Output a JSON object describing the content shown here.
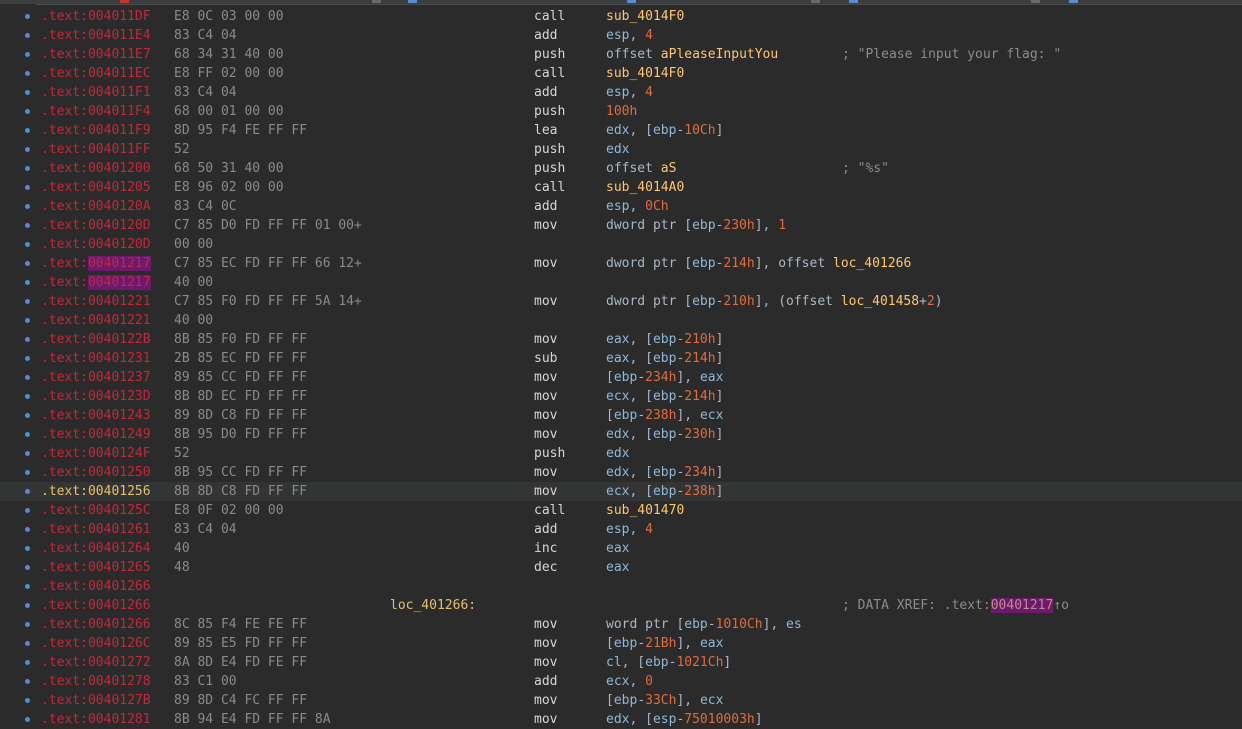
{
  "rows": [
    {
      "seg": ".text:",
      "addr": "004011DF",
      "bytes": "E8 0C 03 00 00",
      "mnem": "call",
      "ops": [
        {
          "t": "sub_4014F0",
          "c": "sym"
        }
      ]
    },
    {
      "seg": ".text:",
      "addr": "004011E4",
      "bytes": "83 C4 04",
      "mnem": "add",
      "ops": [
        {
          "t": "esp",
          "c": "reg"
        },
        {
          "t": ", "
        },
        {
          "t": "4",
          "c": "num"
        }
      ]
    },
    {
      "seg": ".text:",
      "addr": "004011E7",
      "bytes": "68 34 31 40 00",
      "mnem": "push",
      "ops": [
        {
          "t": "offset "
        },
        {
          "t": "aPleaseInputYou",
          "c": "sym"
        }
      ],
      "comment": "; \"Please input your flag: \""
    },
    {
      "seg": ".text:",
      "addr": "004011EC",
      "bytes": "E8 FF 02 00 00",
      "mnem": "call",
      "ops": [
        {
          "t": "sub_4014F0",
          "c": "sym"
        }
      ]
    },
    {
      "seg": ".text:",
      "addr": "004011F1",
      "bytes": "83 C4 04",
      "mnem": "add",
      "ops": [
        {
          "t": "esp",
          "c": "reg"
        },
        {
          "t": ", "
        },
        {
          "t": "4",
          "c": "num"
        }
      ]
    },
    {
      "seg": ".text:",
      "addr": "004011F4",
      "bytes": "68 00 01 00 00",
      "mnem": "push",
      "ops": [
        {
          "t": "100h",
          "c": "num"
        }
      ]
    },
    {
      "seg": ".text:",
      "addr": "004011F9",
      "bytes": "8D 95 F4 FE FF FF",
      "mnem": "lea",
      "ops": [
        {
          "t": "edx",
          "c": "reg"
        },
        {
          "t": ", ["
        },
        {
          "t": "ebp",
          "c": "reg"
        },
        {
          "t": "-"
        },
        {
          "t": "10Ch",
          "c": "num"
        },
        {
          "t": "]"
        }
      ]
    },
    {
      "seg": ".text:",
      "addr": "004011FF",
      "bytes": "52",
      "mnem": "push",
      "ops": [
        {
          "t": "edx",
          "c": "reg"
        }
      ]
    },
    {
      "seg": ".text:",
      "addr": "00401200",
      "bytes": "68 50 31 40 00",
      "mnem": "push",
      "ops": [
        {
          "t": "offset "
        },
        {
          "t": "aS",
          "c": "sym"
        }
      ],
      "comment": "; \"%s\""
    },
    {
      "seg": ".text:",
      "addr": "00401205",
      "bytes": "E8 96 02 00 00",
      "mnem": "call",
      "ops": [
        {
          "t": "sub_4014A0",
          "c": "sym"
        }
      ]
    },
    {
      "seg": ".text:",
      "addr": "0040120A",
      "bytes": "83 C4 0C",
      "mnem": "add",
      "ops": [
        {
          "t": "esp",
          "c": "reg"
        },
        {
          "t": ", "
        },
        {
          "t": "0Ch",
          "c": "num"
        }
      ]
    },
    {
      "seg": ".text:",
      "addr": "0040120D",
      "bytes": "C7 85 D0 FD FF FF 01 00+",
      "mnem": "mov",
      "ops": [
        {
          "t": "dword ptr ["
        },
        {
          "t": "ebp",
          "c": "reg"
        },
        {
          "t": "-"
        },
        {
          "t": "230h",
          "c": "num"
        },
        {
          "t": "], "
        },
        {
          "t": "1",
          "c": "num"
        }
      ]
    },
    {
      "seg": ".text:",
      "addr": "0040120D",
      "bytes": "00 00"
    },
    {
      "seg": ".text:",
      "addr": "00401217",
      "addrHl": true,
      "bytes": "C7 85 EC FD FF FF 66 12+",
      "mnem": "mov",
      "ops": [
        {
          "t": "dword ptr ["
        },
        {
          "t": "ebp",
          "c": "reg"
        },
        {
          "t": "-"
        },
        {
          "t": "214h",
          "c": "num"
        },
        {
          "t": "], offset "
        },
        {
          "t": "loc_401266",
          "c": "sym"
        }
      ]
    },
    {
      "seg": ".text:",
      "addr": "00401217",
      "addrHl": true,
      "bytes": "40 00"
    },
    {
      "seg": ".text:",
      "addr": "00401221",
      "bytes": "C7 85 F0 FD FF FF 5A 14+",
      "mnem": "mov",
      "ops": [
        {
          "t": "dword ptr ["
        },
        {
          "t": "ebp",
          "c": "reg"
        },
        {
          "t": "-"
        },
        {
          "t": "210h",
          "c": "num"
        },
        {
          "t": "], (offset "
        },
        {
          "t": "loc_401458",
          "c": "sym"
        },
        {
          "t": "+"
        },
        {
          "t": "2",
          "c": "num"
        },
        {
          "t": ")"
        }
      ]
    },
    {
      "seg": ".text:",
      "addr": "00401221",
      "bytes": "40 00"
    },
    {
      "seg": ".text:",
      "addr": "0040122B",
      "bytes": "8B 85 F0 FD FF FF",
      "mnem": "mov",
      "ops": [
        {
          "t": "eax",
          "c": "reg"
        },
        {
          "t": ", ["
        },
        {
          "t": "ebp",
          "c": "reg"
        },
        {
          "t": "-"
        },
        {
          "t": "210h",
          "c": "num"
        },
        {
          "t": "]"
        }
      ]
    },
    {
      "seg": ".text:",
      "addr": "00401231",
      "bytes": "2B 85 EC FD FF FF",
      "mnem": "sub",
      "ops": [
        {
          "t": "eax",
          "c": "reg"
        },
        {
          "t": ", ["
        },
        {
          "t": "ebp",
          "c": "reg"
        },
        {
          "t": "-"
        },
        {
          "t": "214h",
          "c": "num"
        },
        {
          "t": "]"
        }
      ]
    },
    {
      "seg": ".text:",
      "addr": "00401237",
      "bytes": "89 85 CC FD FF FF",
      "mnem": "mov",
      "ops": [
        {
          "t": "["
        },
        {
          "t": "ebp",
          "c": "reg"
        },
        {
          "t": "-"
        },
        {
          "t": "234h",
          "c": "num"
        },
        {
          "t": "], "
        },
        {
          "t": "eax",
          "c": "reg"
        }
      ]
    },
    {
      "seg": ".text:",
      "addr": "0040123D",
      "bytes": "8B 8D EC FD FF FF",
      "mnem": "mov",
      "ops": [
        {
          "t": "ecx",
          "c": "reg"
        },
        {
          "t": ", ["
        },
        {
          "t": "ebp",
          "c": "reg"
        },
        {
          "t": "-"
        },
        {
          "t": "214h",
          "c": "num"
        },
        {
          "t": "]"
        }
      ]
    },
    {
      "seg": ".text:",
      "addr": "00401243",
      "bytes": "89 8D C8 FD FF FF",
      "mnem": "mov",
      "ops": [
        {
          "t": "["
        },
        {
          "t": "ebp",
          "c": "reg"
        },
        {
          "t": "-"
        },
        {
          "t": "238h",
          "c": "num"
        },
        {
          "t": "], "
        },
        {
          "t": "ecx",
          "c": "reg"
        }
      ]
    },
    {
      "seg": ".text:",
      "addr": "00401249",
      "bytes": "8B 95 D0 FD FF FF",
      "mnem": "mov",
      "ops": [
        {
          "t": "edx",
          "c": "reg"
        },
        {
          "t": ", ["
        },
        {
          "t": "ebp",
          "c": "reg"
        },
        {
          "t": "-"
        },
        {
          "t": "230h",
          "c": "num"
        },
        {
          "t": "]"
        }
      ]
    },
    {
      "seg": ".text:",
      "addr": "0040124F",
      "bytes": "52",
      "mnem": "push",
      "ops": [
        {
          "t": "edx",
          "c": "reg"
        }
      ]
    },
    {
      "seg": ".text:",
      "addr": "00401250",
      "bytes": "8B 95 CC FD FF FF",
      "mnem": "mov",
      "ops": [
        {
          "t": "edx",
          "c": "reg"
        },
        {
          "t": ", ["
        },
        {
          "t": "ebp",
          "c": "reg"
        },
        {
          "t": "-"
        },
        {
          "t": "234h",
          "c": "num"
        },
        {
          "t": "]"
        }
      ]
    },
    {
      "seg": ".text:",
      "addr": "00401256",
      "current": true,
      "bytes": "8B 8D C8 FD FF FF",
      "mnem": "mov",
      "ops": [
        {
          "t": "ecx",
          "c": "reg"
        },
        {
          "t": ", ["
        },
        {
          "t": "ebp",
          "c": "reg"
        },
        {
          "t": "-"
        },
        {
          "t": "238h",
          "c": "num"
        },
        {
          "t": "]"
        }
      ]
    },
    {
      "seg": ".text:",
      "addr": "0040125C",
      "bytes": "E8 0F 02 00 00",
      "mnem": "call",
      "ops": [
        {
          "t": "sub_401470",
          "c": "sym"
        }
      ]
    },
    {
      "seg": ".text:",
      "addr": "00401261",
      "bytes": "83 C4 04",
      "mnem": "add",
      "ops": [
        {
          "t": "esp",
          "c": "reg"
        },
        {
          "t": ", "
        },
        {
          "t": "4",
          "c": "num"
        }
      ]
    },
    {
      "seg": ".text:",
      "addr": "00401264",
      "bytes": "40",
      "mnem": "inc",
      "ops": [
        {
          "t": "eax",
          "c": "reg"
        }
      ]
    },
    {
      "seg": ".text:",
      "addr": "00401265",
      "bytes": "48",
      "mnem": "dec",
      "ops": [
        {
          "t": "eax",
          "c": "reg"
        }
      ]
    },
    {
      "seg": ".text:",
      "addr": "00401266"
    },
    {
      "seg": ".text:",
      "addr": "00401266",
      "label": "loc_401266:",
      "comment": "; DATA XREF: .text:",
      "xref": "00401217",
      "xrefTail": "↑o"
    },
    {
      "seg": ".text:",
      "addr": "00401266",
      "bytes": "8C 85 F4 FE FE FF",
      "mnem": "mov",
      "ops": [
        {
          "t": "word ptr ["
        },
        {
          "t": "ebp",
          "c": "reg"
        },
        {
          "t": "-"
        },
        {
          "t": "1010Ch",
          "c": "num"
        },
        {
          "t": "], "
        },
        {
          "t": "es",
          "c": "reg"
        }
      ]
    },
    {
      "seg": ".text:",
      "addr": "0040126C",
      "bytes": "89 85 E5 FD FF FF",
      "mnem": "mov",
      "ops": [
        {
          "t": "["
        },
        {
          "t": "ebp",
          "c": "reg"
        },
        {
          "t": "-"
        },
        {
          "t": "21Bh",
          "c": "num"
        },
        {
          "t": "], "
        },
        {
          "t": "eax",
          "c": "reg"
        }
      ]
    },
    {
      "seg": ".text:",
      "addr": "00401272",
      "bytes": "8A 8D E4 FD FE FF",
      "mnem": "mov",
      "ops": [
        {
          "t": "cl",
          "c": "reg"
        },
        {
          "t": ", ["
        },
        {
          "t": "ebp",
          "c": "reg"
        },
        {
          "t": "-"
        },
        {
          "t": "1021Ch",
          "c": "num"
        },
        {
          "t": "]"
        }
      ]
    },
    {
      "seg": ".text:",
      "addr": "00401278",
      "bytes": "83 C1 00",
      "mnem": "add",
      "ops": [
        {
          "t": "ecx",
          "c": "reg"
        },
        {
          "t": ", "
        },
        {
          "t": "0",
          "c": "num"
        }
      ]
    },
    {
      "seg": ".text:",
      "addr": "0040127B",
      "bytes": "89 8D C4 FC FF FF",
      "mnem": "mov",
      "ops": [
        {
          "t": "["
        },
        {
          "t": "ebp",
          "c": "reg"
        },
        {
          "t": "-"
        },
        {
          "t": "33Ch",
          "c": "num"
        },
        {
          "t": "], "
        },
        {
          "t": "ecx",
          "c": "reg"
        }
      ]
    },
    {
      "seg": ".text:",
      "addr": "00401281",
      "bytes": "8B 94 E4 FD FF FF 8A",
      "mnem": "mov",
      "ops": [
        {
          "t": "edx",
          "c": "reg"
        },
        {
          "t": ", ["
        },
        {
          "t": "esp",
          "c": "reg"
        },
        {
          "t": "-"
        },
        {
          "t": "75010003h",
          "c": "num"
        },
        {
          "t": "]"
        }
      ]
    }
  ]
}
